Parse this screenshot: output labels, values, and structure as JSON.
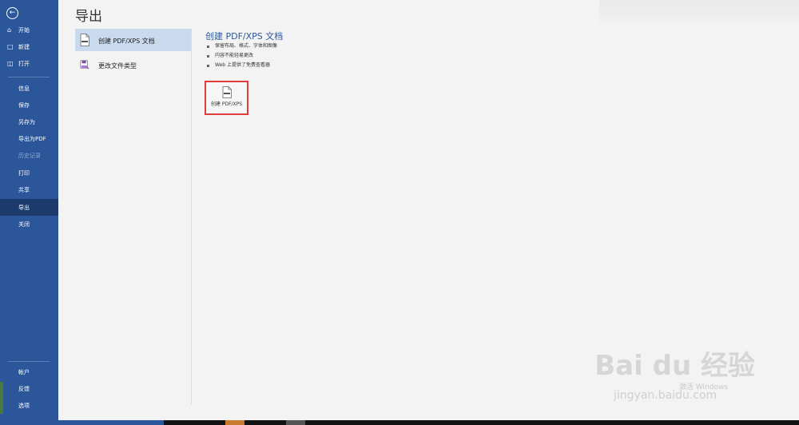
{
  "sidebar": {
    "items": [
      {
        "label": "开始",
        "icon": "home-icon",
        "state": "normal"
      },
      {
        "label": "新建",
        "icon": "new-document-icon",
        "state": "normal"
      },
      {
        "label": "打开",
        "icon": "open-folder-icon",
        "state": "normal"
      },
      {
        "label": "信息",
        "state": "normal"
      },
      {
        "label": "保存",
        "state": "normal"
      },
      {
        "label": "另存为",
        "state": "normal"
      },
      {
        "label": "导出为PDF",
        "state": "normal"
      },
      {
        "label": "历史记录",
        "state": "disabled"
      },
      {
        "label": "打印",
        "state": "normal"
      },
      {
        "label": "共享",
        "state": "normal"
      },
      {
        "label": "导出",
        "state": "active"
      },
      {
        "label": "关闭",
        "state": "normal"
      }
    ],
    "bottom": [
      {
        "label": "帐户"
      },
      {
        "label": "反馈"
      },
      {
        "label": "选项"
      }
    ]
  },
  "page": {
    "title": "导出"
  },
  "options": [
    {
      "label": "创建 PDF/XPS 文档",
      "icon": "pdf-document-icon"
    },
    {
      "label": "更改文件类型",
      "icon": "change-file-type-icon"
    }
  ],
  "detail": {
    "title": "创建 PDF/XPS 文档",
    "bullets": [
      "保留布局、格式、字体和图像",
      "内容不能轻易更改",
      "Web 上提供了免费查看器"
    ],
    "button_label": "创建 PDF/XPS"
  },
  "watermark": {
    "brand": "Bai du 经验",
    "url": "jingyan.baidu.com",
    "windows_activation": "激活 Windows"
  },
  "colors": {
    "sidebar": "#2b579a",
    "accent": "#2b579a",
    "highlight": "#e03c3c"
  }
}
